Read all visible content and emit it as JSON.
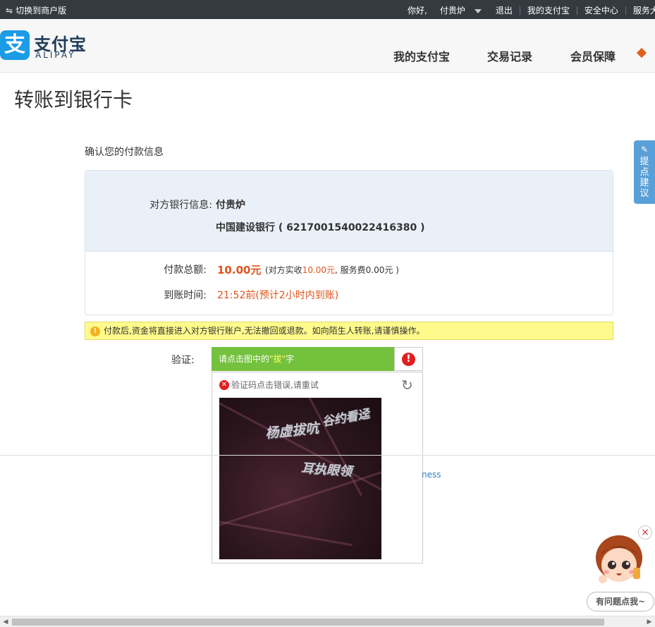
{
  "topbar": {
    "switch_label": "切换到商户版",
    "greeting": "你好,",
    "user": "付贵炉",
    "logout": "退出",
    "my_alipay": "我的支付宝",
    "security": "安全中心",
    "service": "服务大"
  },
  "header": {
    "logo_glyph": "支",
    "logo_cn": "支付宝",
    "logo_en": "ALIPAY",
    "nav": [
      "我的支付宝",
      "交易记录",
      "会员保障"
    ]
  },
  "page": {
    "title": "转账到银行卡",
    "section_title": "确认您的付款信息"
  },
  "payee": {
    "label": "对方银行信息:",
    "name": "付贵炉",
    "bank": "中国建设银行 ( 6217001540022416380 )"
  },
  "payment": {
    "amount_label": "付款总额:",
    "amount": "10.00元",
    "detail_prefix": "(对方实收",
    "detail_received": "10.00元",
    "detail_suffix": ", 服务费0.00元 )",
    "time_label": "到账时间:",
    "time_value": "21:52前(预计2小时内到账)"
  },
  "warning": {
    "text": "付款后,资金将直接进入对方银行账户,无法撤回或退款。如向陌生人转账,请谨慎操作。"
  },
  "verify": {
    "label": "验证:",
    "prompt_pre": "请点击图中的",
    "prompt_char": "\"拔\"",
    "prompt_post": "字",
    "error_text": "验证码点击错误,请重试",
    "captcha_words": [
      "谷约看迳",
      "杨虚拔吭",
      "耳执眼领"
    ]
  },
  "footer": {
    "link_fragment": "ness"
  },
  "side": {
    "feedback": "提点建议"
  },
  "mascot": {
    "bubble": "有问题点我~"
  },
  "colors": {
    "topbar": "#333a40",
    "brand_blue": "#1c9be6",
    "accent_orange": "#e0541c",
    "verify_green": "#73c13c",
    "warning_yellow": "#fffa8c"
  }
}
